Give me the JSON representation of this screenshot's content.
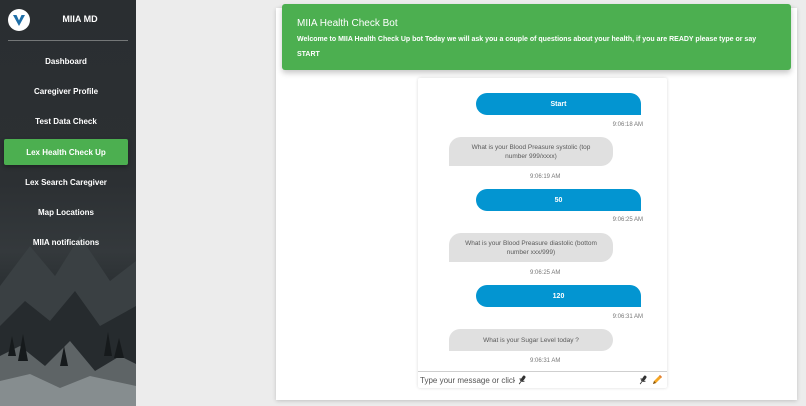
{
  "sidebar": {
    "brand": "MIIA MD",
    "items": [
      {
        "label": "Dashboard",
        "active": false
      },
      {
        "label": "Caregiver Profile",
        "active": false
      },
      {
        "label": "Test Data Check",
        "active": false
      },
      {
        "label": "Lex Health Check Up",
        "active": true
      },
      {
        "label": "Lex Search Caregiver",
        "active": false
      },
      {
        "label": "Map Locations",
        "active": false
      },
      {
        "label": "MIIA notifications",
        "active": false
      }
    ]
  },
  "header": {
    "title": "MIIA Health Check Bot",
    "text": "Welcome to MIIA Health Check Up bot Today we will ask you a couple of questions about your health, if you are READY please type or say START"
  },
  "chat": {
    "messages": [
      {
        "from": "user",
        "text": "Start",
        "time": "9:06:18 AM"
      },
      {
        "from": "bot",
        "text": "What is your Blood Preasure systolic (top number 999/xxxx)",
        "time": "9:06:19 AM"
      },
      {
        "from": "user",
        "text": "50",
        "time": "9:06:25 AM"
      },
      {
        "from": "bot",
        "text": "What is your Blood Preasure diastolic (bottom number xxx/999)",
        "time": "9:06:25 AM"
      },
      {
        "from": "user",
        "text": "120",
        "time": "9:06:31 AM"
      },
      {
        "from": "bot",
        "text": "What is your Sugar Level today ?",
        "time": "9:06:31 AM"
      }
    ],
    "input_placeholder": "Type your message or click",
    "icons": [
      "microphone-icon",
      "microphone-icon",
      "pencil-icon"
    ]
  },
  "colors": {
    "accent_green": "#4caf50",
    "user_bubble": "#0395d1",
    "bot_bubble": "#e0e0e0",
    "sidebar_bg": "#2a2e31"
  }
}
